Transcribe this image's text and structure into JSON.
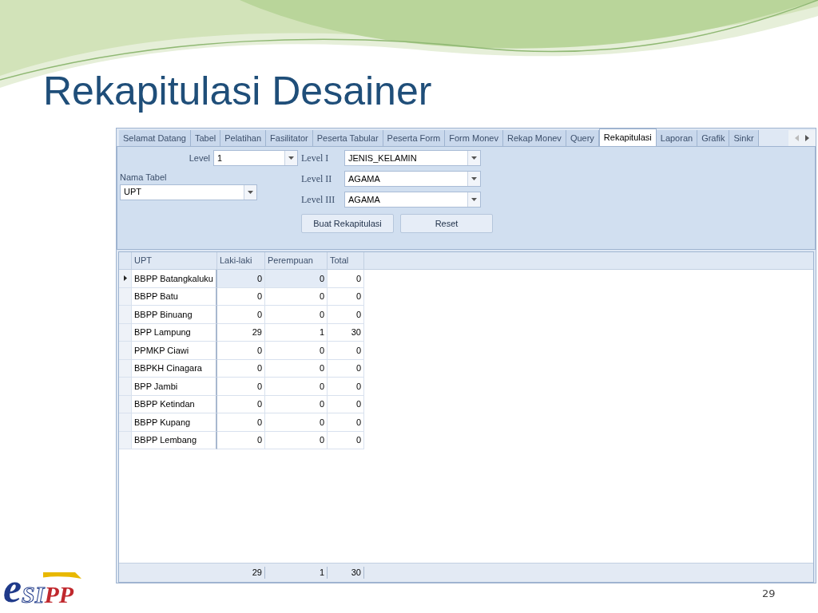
{
  "slide": {
    "title": "Rekapitulasi Desainer",
    "page_number": "29",
    "logo": {
      "parts": [
        "e",
        "SI",
        "PP"
      ]
    }
  },
  "tabs": [
    {
      "label": "Selamat Datang",
      "selected": false
    },
    {
      "label": "Tabel",
      "selected": false
    },
    {
      "label": "Pelatihan",
      "selected": false
    },
    {
      "label": "Fasilitator",
      "selected": false
    },
    {
      "label": "Peserta Tabular",
      "selected": false
    },
    {
      "label": "Peserta Form",
      "selected": false
    },
    {
      "label": "Form Monev",
      "selected": false
    },
    {
      "label": "Rekap Monev",
      "selected": false
    },
    {
      "label": "Query",
      "selected": false
    },
    {
      "label": "Rekapitulasi",
      "selected": true
    },
    {
      "label": "Laporan",
      "selected": false
    },
    {
      "label": "Grafik",
      "selected": false
    },
    {
      "label": "Sinkr",
      "selected": false
    }
  ],
  "form": {
    "level": {
      "label": "Level",
      "value": "1"
    },
    "nama_tabel": {
      "label": "Nama Tabel",
      "value": "UPT"
    },
    "levels": [
      {
        "label": "Level I",
        "value": "JENIS_KELAMIN"
      },
      {
        "label": "Level II",
        "value": "AGAMA"
      },
      {
        "label": "Level III",
        "value": "AGAMA"
      }
    ],
    "buttons": [
      "Buat Rekapitulasi",
      "Reset"
    ]
  },
  "table": {
    "columns": [
      "UPT",
      "Laki-laki",
      "Perempuan",
      "Total"
    ],
    "rows": [
      {
        "cells": [
          "BBPP Batangkaluku",
          "0",
          "0",
          "0"
        ],
        "selected": true
      },
      {
        "cells": [
          "BBPP Batu",
          "0",
          "0",
          "0"
        ],
        "selected": false
      },
      {
        "cells": [
          "BBPP Binuang",
          "0",
          "0",
          "0"
        ],
        "selected": false
      },
      {
        "cells": [
          "BPP Lampung",
          "29",
          "1",
          "30"
        ],
        "selected": false
      },
      {
        "cells": [
          "PPMKP Ciawi",
          "0",
          "0",
          "0"
        ],
        "selected": false
      },
      {
        "cells": [
          "BBPKH Cinagara",
          "0",
          "0",
          "0"
        ],
        "selected": false
      },
      {
        "cells": [
          "BPP Jambi",
          "0",
          "0",
          "0"
        ],
        "selected": false
      },
      {
        "cells": [
          "BBPP Ketindan",
          "0",
          "0",
          "0"
        ],
        "selected": false
      },
      {
        "cells": [
          "BBPP Kupang",
          "0",
          "0",
          "0"
        ],
        "selected": false
      },
      {
        "cells": [
          "BBPP Lembang",
          "0",
          "0",
          "0"
        ],
        "selected": false
      }
    ],
    "totals": [
      "29",
      "1",
      "30"
    ]
  }
}
